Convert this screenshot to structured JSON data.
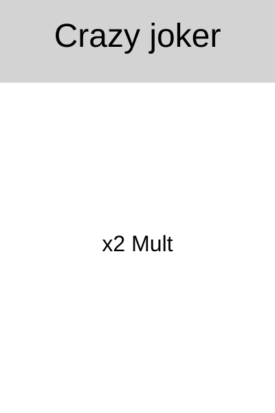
{
  "card": {
    "title": "Crazy joker",
    "effect": "x2 Mult",
    "colors": {
      "header_background": "#d3d3d3",
      "body_background": "#ffffff",
      "text": "#000000"
    }
  }
}
